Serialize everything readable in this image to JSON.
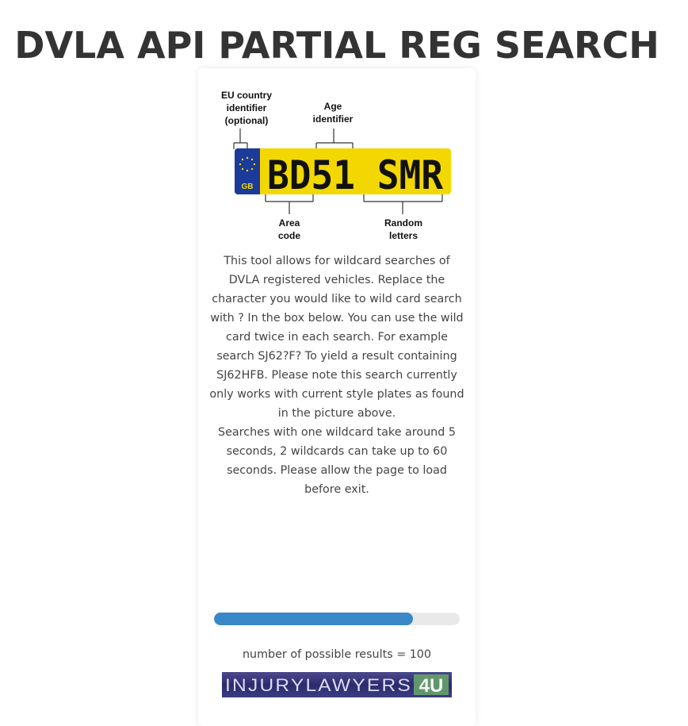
{
  "page": {
    "title": "DVLA API PARTIAL REG SEARCH"
  },
  "plate_diagram": {
    "labels": {
      "eu_line1": "EU country",
      "eu_line2": "identifier",
      "eu_line3": "(optional)",
      "age_line1": "Age",
      "age_line2": "identifier",
      "area_line1": "Area",
      "area_line2": "code",
      "random_line1": "Random",
      "random_line2": "letters"
    },
    "plate_text": "BD51 SMR",
    "country_code": "GB",
    "plate_color": "#f2d800",
    "euband_color": "#1c3a9a"
  },
  "description": {
    "paragraph1": "This tool allows for wildcard searches of DVLA registered vehicles. Replace the character you would like to wild card search with ? In the box below. You can use the wild card twice in each search. For example search SJ62?F? To yield a result containing SJ62HFB. Please note this search currently only works with current style plates as found in the picture above.",
    "paragraph2": "Searches with one wildcard take around 5 seconds, 2 wildcards can take up to 60 seconds. Please allow the page to load before exit."
  },
  "progress": {
    "fraction": 0.81,
    "color": "#3a88c8"
  },
  "results": {
    "text": "number of possible results = 100"
  },
  "ad": {
    "text": "INJURYLAWYERS",
    "logo_suffix": "4U"
  }
}
